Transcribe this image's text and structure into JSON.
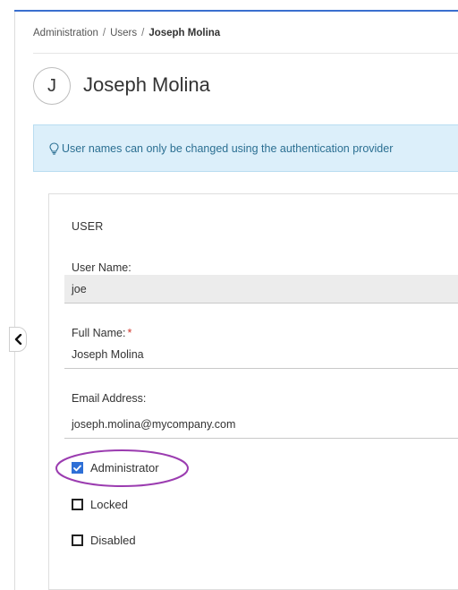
{
  "breadcrumb": {
    "items": [
      "Administration",
      "Users"
    ],
    "separator": "/",
    "current": "Joseph Molina"
  },
  "profile": {
    "avatar_initial": "J",
    "title": "Joseph Molina"
  },
  "info_banner": {
    "icon": "lightbulb-icon",
    "text": "User names can only be changed using the authentication provider"
  },
  "user_section": {
    "title": "USER",
    "fields": {
      "username": {
        "label": "User Name:",
        "value": "joe"
      },
      "fullname": {
        "label": "Full Name:",
        "required_marker": "*",
        "value": "Joseph Molina"
      },
      "email": {
        "label": "Email Address:",
        "value": "joseph.molina@mycompany.com"
      }
    },
    "checkboxes": {
      "administrator": {
        "label": "Administrator",
        "checked": true
      },
      "locked": {
        "label": "Locked",
        "checked": false
      },
      "disabled": {
        "label": "Disabled",
        "checked": false
      }
    }
  },
  "colors": {
    "accent": "#3a6fcf",
    "checkbox_checked": "#2e6fd6",
    "info_bg": "#dceffa",
    "info_text": "#2b6f92",
    "required": "#d0352b",
    "highlight_annotation": "#9b3cb0"
  }
}
